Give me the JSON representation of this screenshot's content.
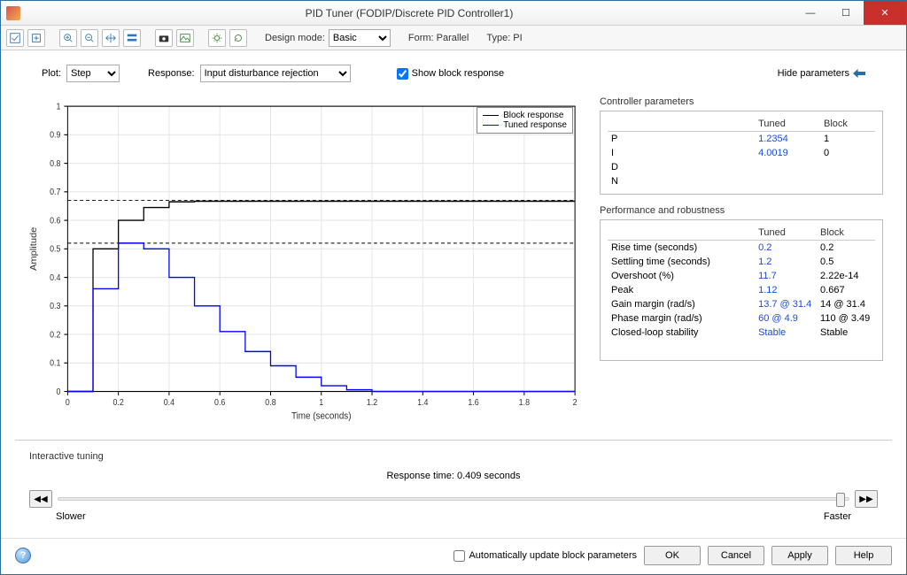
{
  "window": {
    "title": "PID Tuner (FODIP/Discrete PID Controller1)"
  },
  "toolbar": {
    "design_mode_label": "Design mode:",
    "design_mode_value": "Basic",
    "form_label": "Form: Parallel",
    "type_label": "Type: PI"
  },
  "controls": {
    "plot_label": "Plot:",
    "plot_value": "Step",
    "response_label": "Response:",
    "response_value": "Input disturbance rejection",
    "show_block_label": "Show block response",
    "hide_params_label": "Hide parameters"
  },
  "legend": {
    "block": "Block response",
    "tuned": "Tuned response"
  },
  "chart_data": {
    "type": "line",
    "xlabel": "Time (seconds)",
    "ylabel": "Amplitude",
    "xlim": [
      0,
      2
    ],
    "ylim": [
      0,
      1
    ],
    "xticks": [
      0,
      0.2,
      0.4,
      0.6,
      0.8,
      1,
      1.2,
      1.4,
      1.6,
      1.8,
      2
    ],
    "yticks": [
      0,
      0.1,
      0.2,
      0.3,
      0.4,
      0.5,
      0.6,
      0.7,
      0.8,
      0.9,
      1
    ],
    "dashed_y": [
      0.52,
      0.67
    ],
    "series": [
      {
        "name": "Block response",
        "color": "#000000",
        "x": [
          0.0,
          0.1,
          0.1,
          0.2,
          0.2,
          0.3,
          0.3,
          0.4,
          0.4,
          0.5,
          0.5,
          2.0
        ],
        "y": [
          0.0,
          0.0,
          0.5,
          0.5,
          0.6,
          0.6,
          0.645,
          0.645,
          0.665,
          0.665,
          0.667,
          0.667
        ]
      },
      {
        "name": "Tuned response",
        "color": "#0000ff",
        "x": [
          0.0,
          0.1,
          0.1,
          0.2,
          0.2,
          0.3,
          0.3,
          0.4,
          0.4,
          0.5,
          0.5,
          0.6,
          0.6,
          0.7,
          0.7,
          0.8,
          0.8,
          0.9,
          0.9,
          1.0,
          1.0,
          1.1,
          1.1,
          1.2,
          1.2,
          2.0
        ],
        "y": [
          0.0,
          0.0,
          0.36,
          0.36,
          0.52,
          0.52,
          0.5,
          0.5,
          0.4,
          0.4,
          0.3,
          0.3,
          0.21,
          0.21,
          0.14,
          0.14,
          0.09,
          0.09,
          0.05,
          0.05,
          0.02,
          0.02,
          0.006,
          0.006,
          0.0,
          0.0
        ]
      }
    ]
  },
  "ctrl_params": {
    "title": "Controller parameters",
    "cols": {
      "tuned": "Tuned",
      "block": "Block"
    },
    "rows": [
      {
        "name": "P",
        "tuned": "1.2354",
        "block": "1"
      },
      {
        "name": "I",
        "tuned": "4.0019",
        "block": "0"
      },
      {
        "name": "D",
        "tuned": "",
        "block": ""
      },
      {
        "name": "N",
        "tuned": "",
        "block": ""
      }
    ]
  },
  "perf": {
    "title": "Performance and robustness",
    "cols": {
      "tuned": "Tuned",
      "block": "Block"
    },
    "rows": [
      {
        "name": "Rise time (seconds)",
        "tuned": "0.2",
        "block": "0.2"
      },
      {
        "name": "Settling time (seconds)",
        "tuned": "1.2",
        "block": "0.5"
      },
      {
        "name": "Overshoot (%)",
        "tuned": "11.7",
        "block": "2.22e-14"
      },
      {
        "name": "Peak",
        "tuned": "1.12",
        "block": "0.667"
      },
      {
        "name": "Gain margin (rad/s)",
        "tuned": "13.7 @ 31.4",
        "block": "14 @ 31.4"
      },
      {
        "name": "Phase margin (rad/s)",
        "tuned": "60 @ 4.9",
        "block": "110 @ 3.49"
      },
      {
        "name": "Closed-loop stability",
        "tuned": "Stable",
        "block": "Stable"
      }
    ]
  },
  "tuning": {
    "title": "Interactive tuning",
    "response_time": "Response time: 0.409 seconds",
    "slower": "Slower",
    "faster": "Faster"
  },
  "footer": {
    "auto_update": "Automatically update block parameters",
    "ok": "OK",
    "cancel": "Cancel",
    "apply": "Apply",
    "help": "Help"
  }
}
